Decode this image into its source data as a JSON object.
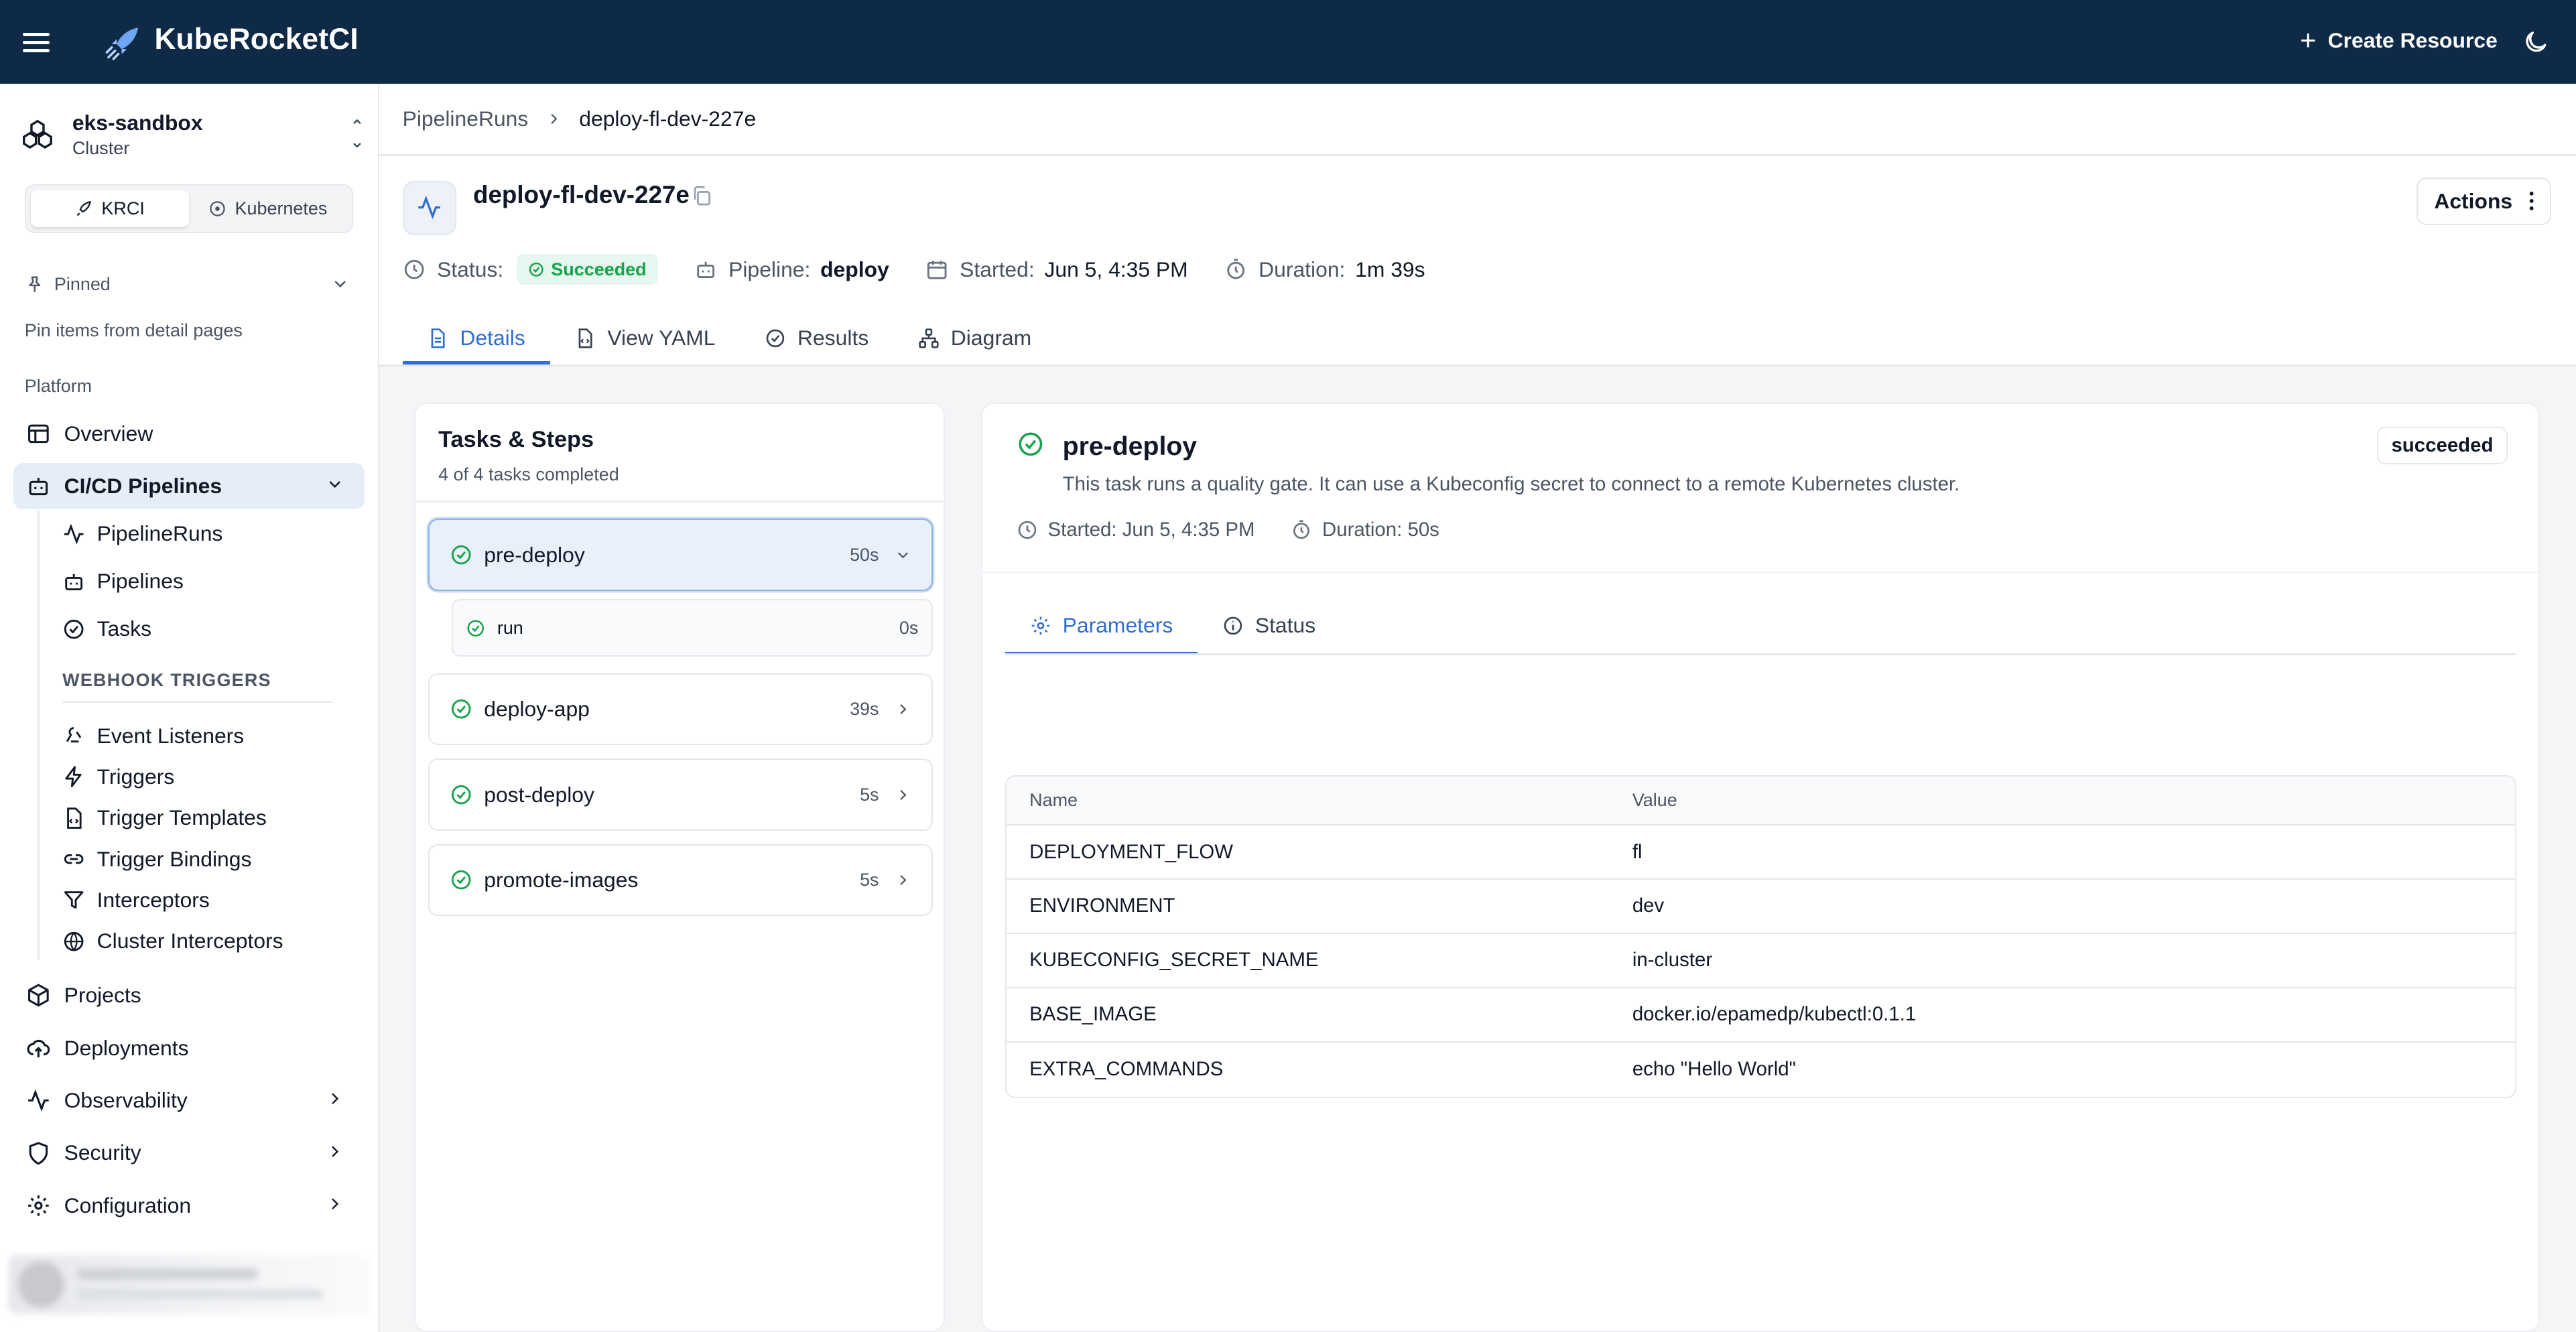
{
  "app": {
    "brand": "KubeRocketCI",
    "create_label": "Create Resource"
  },
  "sidebar": {
    "cluster_name": "eks-sandbox",
    "cluster_sub": "Cluster",
    "modes": [
      "KRCI",
      "Kubernetes"
    ],
    "pinned_label": "Pinned",
    "pinned_hint": "Pin items from detail pages",
    "platform_label": "Platform",
    "overview": "Overview",
    "cicd": "CI/CD Pipelines",
    "cicd_items": [
      "PipelineRuns",
      "Pipelines",
      "Tasks"
    ],
    "webhook_label": "WEBHOOK TRIGGERS",
    "webhook_items": [
      "Event Listeners",
      "Triggers",
      "Trigger Templates",
      "Trigger Bindings",
      "Interceptors",
      "Cluster Interceptors"
    ],
    "bottom_items": [
      "Projects",
      "Deployments",
      "Observability",
      "Security",
      "Configuration"
    ]
  },
  "breadcrumb": {
    "parent": "PipelineRuns",
    "current": "deploy-fl-dev-227e"
  },
  "run": {
    "title": "deploy-fl-dev-227e",
    "actions_label": "Actions",
    "status_label": "Status:",
    "status_value": "Succeeded",
    "pipeline_label": "Pipeline:",
    "pipeline_value": "deploy",
    "started_label": "Started:",
    "started_value": "Jun 5, 4:35 PM",
    "duration_label": "Duration:",
    "duration_value": "1m 39s"
  },
  "tabs": [
    "Details",
    "View YAML",
    "Results",
    "Diagram"
  ],
  "tasks_panel": {
    "title": "Tasks & Steps",
    "subtitle": "4 of 4 tasks completed",
    "tasks": [
      {
        "name": "pre-deploy",
        "duration": "50s"
      },
      {
        "name": "deploy-app",
        "duration": "39s"
      },
      {
        "name": "post-deploy",
        "duration": "5s"
      },
      {
        "name": "promote-images",
        "duration": "5s"
      }
    ],
    "step": {
      "name": "run",
      "duration": "0s"
    }
  },
  "detail": {
    "title": "pre-deploy",
    "description": "This task runs a quality gate. It can use a Kubeconfig secret to connect to a remote Kubernetes cluster.",
    "badge": "succeeded",
    "started": "Started: Jun 5, 4:35 PM",
    "duration": "Duration: 50s",
    "tabs": [
      "Parameters",
      "Status"
    ],
    "table_headers": [
      "Name",
      "Value"
    ],
    "params": [
      {
        "name": "DEPLOYMENT_FLOW",
        "value": "fl"
      },
      {
        "name": "ENVIRONMENT",
        "value": "dev"
      },
      {
        "name": "KUBECONFIG_SECRET_NAME",
        "value": "in-cluster"
      },
      {
        "name": "BASE_IMAGE",
        "value": "docker.io/epamedp/kubectl:0.1.1"
      },
      {
        "name": "EXTRA_COMMANDS",
        "value": "echo \"Hello World\""
      }
    ]
  },
  "colors": {
    "topbar": "#0f2a47",
    "accent": "#2f6fd1",
    "success": "#16a34a"
  }
}
